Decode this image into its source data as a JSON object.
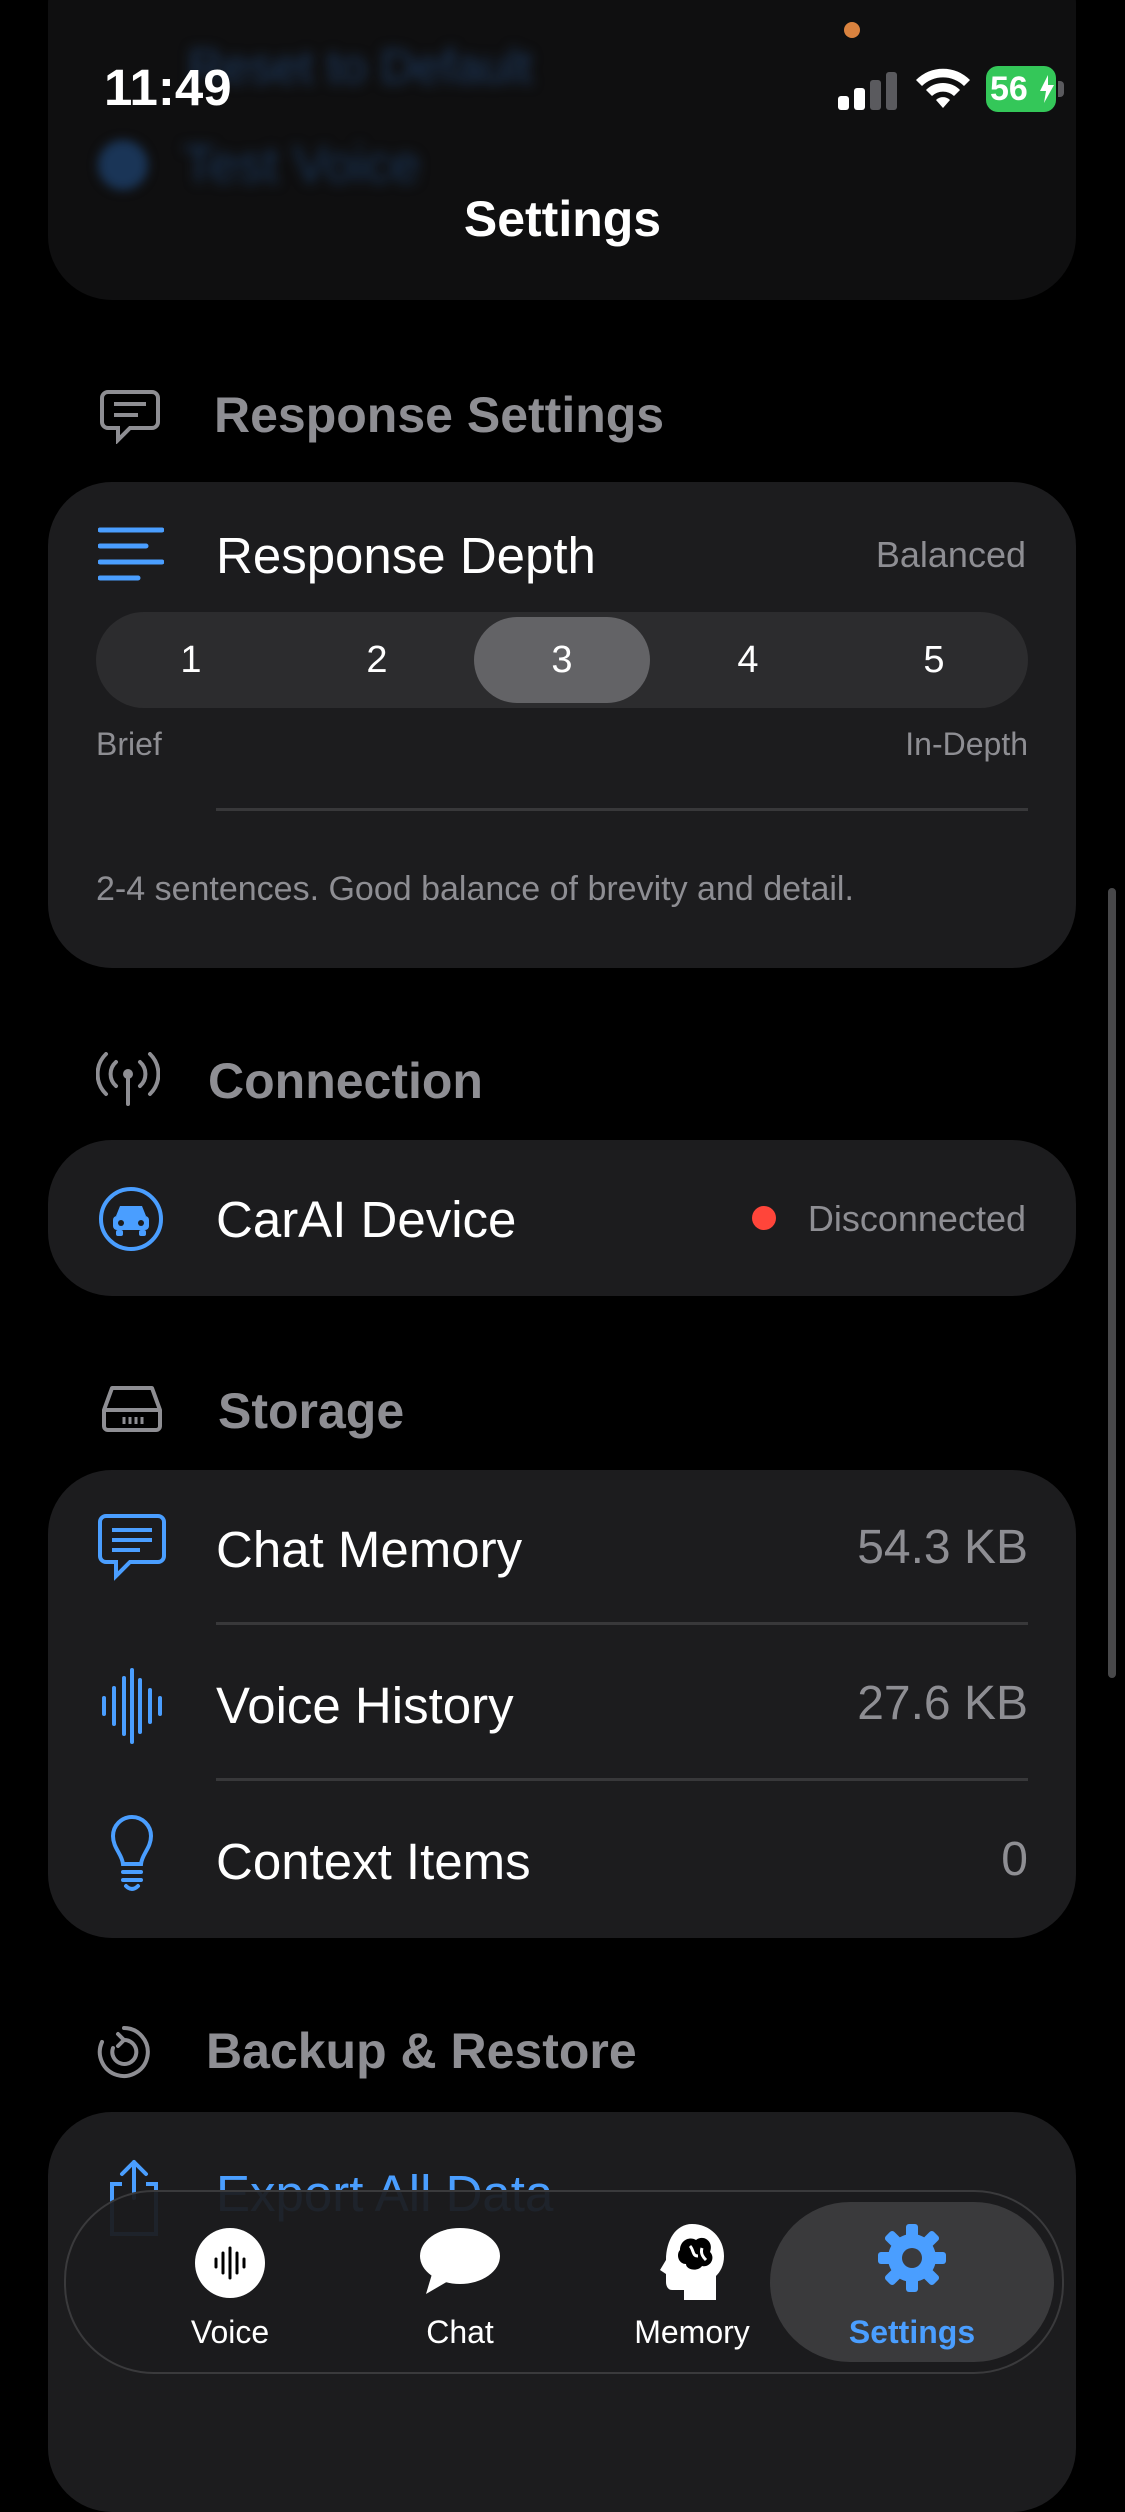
{
  "status_bar": {
    "time": "11:49",
    "battery": "56"
  },
  "nav": {
    "title": "Settings"
  },
  "faded_top": {
    "line1": "Reset to Default",
    "test_voice": "Test Voice"
  },
  "response_settings": {
    "header": "Response Settings",
    "depth_label": "Response Depth",
    "depth_value": "Balanced",
    "options": [
      "1",
      "2",
      "3",
      "4",
      "5"
    ],
    "selected": "3",
    "min_label": "Brief",
    "max_label": "In-Depth",
    "description": "2-4 sentences. Good balance of brevity and detail."
  },
  "connection": {
    "header": "Connection",
    "device_label": "CarAI Device",
    "status": "Disconnected",
    "status_color": "#ff453a"
  },
  "storage": {
    "header": "Storage",
    "items": [
      {
        "label": "Chat Memory",
        "value": "54.3 KB",
        "icon": "chat-bubble-icon"
      },
      {
        "label": "Voice History",
        "value": "27.6 KB",
        "icon": "waveform-icon"
      },
      {
        "label": "Context Items",
        "value": "0",
        "icon": "lightbulb-icon"
      }
    ]
  },
  "backup": {
    "header": "Backup & Restore",
    "export_label": "Export All Data"
  },
  "tabbar": {
    "tabs": [
      {
        "label": "Voice",
        "icon": "waveform-icon"
      },
      {
        "label": "Chat",
        "icon": "chat-bubble-icon"
      },
      {
        "label": "Memory",
        "icon": "brain-head-icon"
      },
      {
        "label": "Settings",
        "icon": "gear-icon"
      }
    ],
    "active": "Settings"
  },
  "colors": {
    "accent": "#4a9eff",
    "card": "#1c1c1e",
    "secondary": "#8e8e93"
  }
}
